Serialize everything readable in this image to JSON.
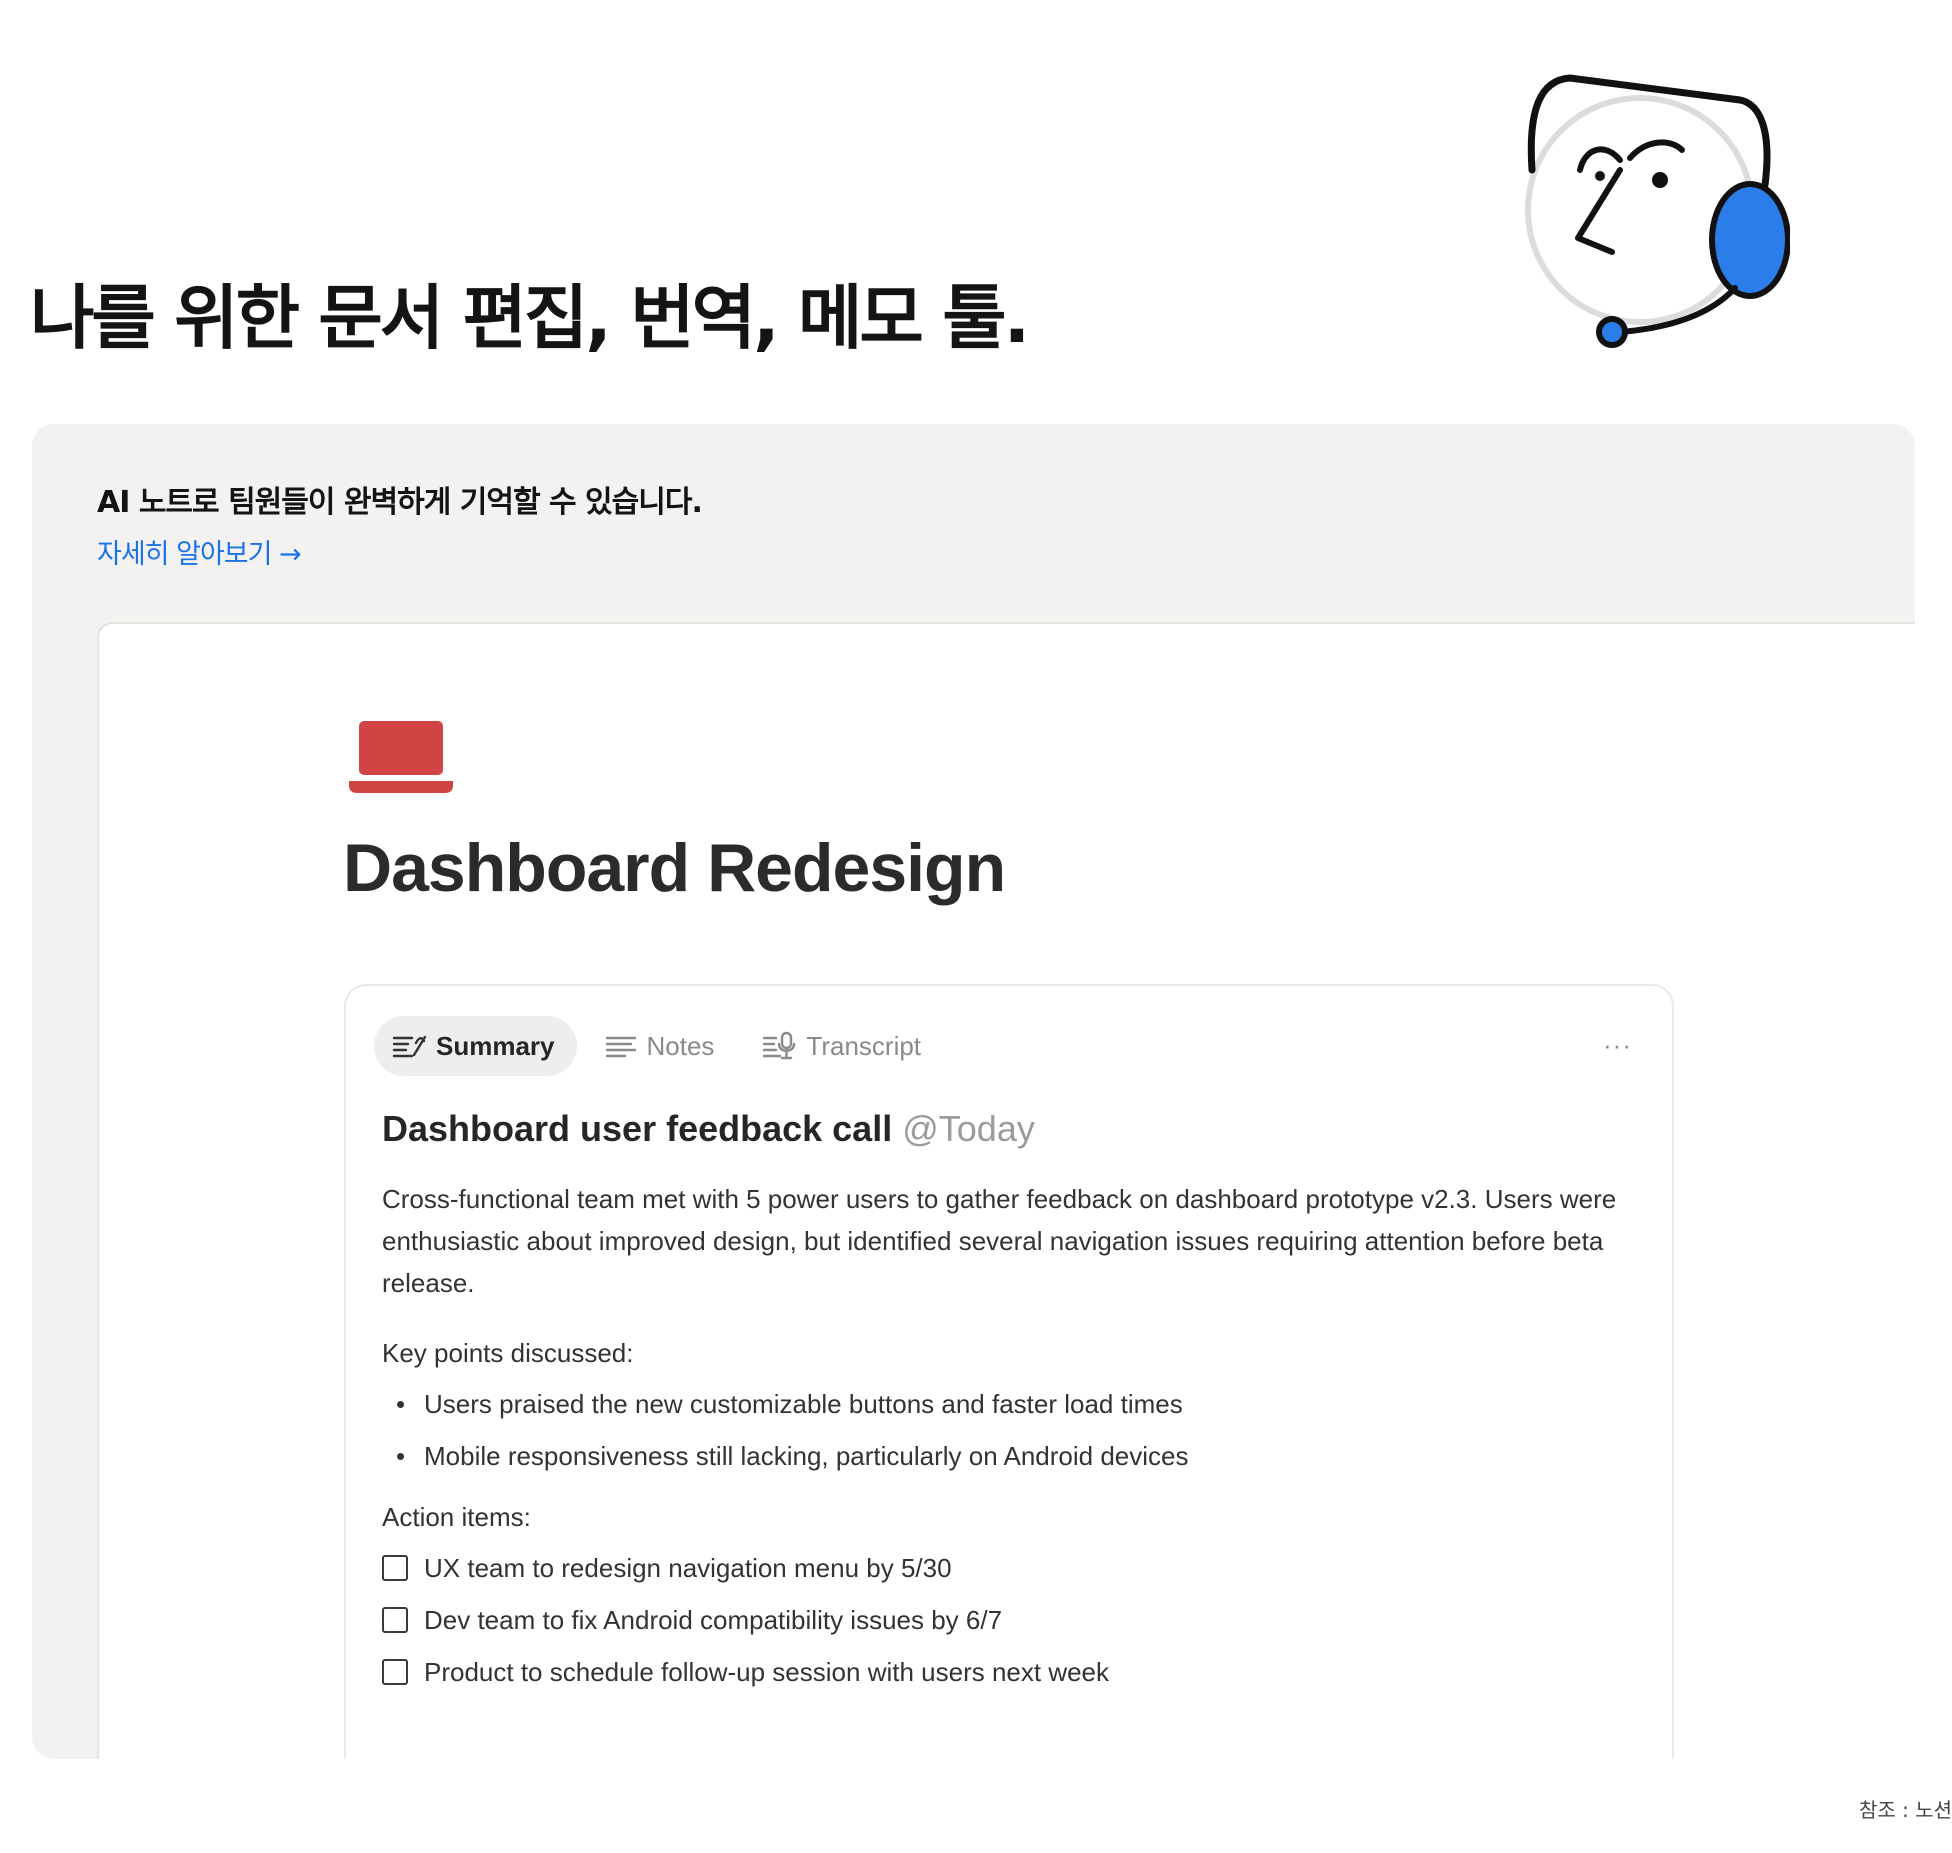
{
  "hero": {
    "title": "나를 위한 문서 편집, 번역, 메모 툴."
  },
  "mascot": {
    "icon": "headset-face-illustration",
    "accent_color": "#2b7de9"
  },
  "feature": {
    "heading": "AI 노트로 팀원들이 완벽하게 기억할 수 있습니다.",
    "link_label": "자세히 알아보기 →",
    "link_color": "#1a73e8"
  },
  "page": {
    "icon": "laptop-icon",
    "icon_color": "#d04444",
    "title": "Dashboard Redesign"
  },
  "ai_block": {
    "tabs": [
      {
        "label": "Summary",
        "icon": "summary-icon",
        "active": true
      },
      {
        "label": "Notes",
        "icon": "notes-icon",
        "active": false
      },
      {
        "label": "Transcript",
        "icon": "transcript-icon",
        "active": false
      }
    ],
    "more_label": "···",
    "meeting_title": "Dashboard user feedback call",
    "meeting_date": "@Today",
    "summary": "Cross-functional team met with 5 power users to gather feedback on dashboard prototype v2.3. Users were enthusiastic about improved design, but identified several navigation issues requiring attention before beta release.",
    "key_points_label": "Key points discussed:",
    "key_points": [
      "Users praised the new customizable buttons and faster load times",
      "Mobile responsiveness still lacking, particularly on Android devices"
    ],
    "action_items_label": "Action items:",
    "action_items": [
      {
        "text": "UX team to redesign navigation menu by 5/30",
        "checked": false
      },
      {
        "text": "Dev team to fix Android compatibility issues by 6/7",
        "checked": false
      },
      {
        "text": "Product to schedule follow-up session with users next week",
        "checked": false
      }
    ]
  },
  "source_note": "참조 : 노션"
}
